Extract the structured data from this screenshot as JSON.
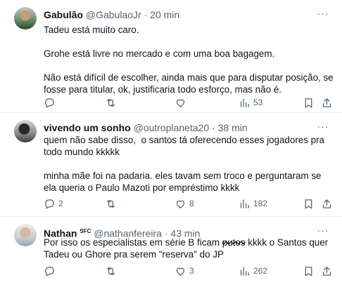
{
  "tweets": [
    {
      "name": "Gabulão",
      "handle": "@GabulaoJr",
      "separator": "·",
      "time": "20 min",
      "badge": "",
      "paragraphs": [
        "Tadeu está muito caro.",
        "Grohe está livre no mercado e com uma boa bagagem.",
        "Não está difícil de escolher, ainda mais que para disputar posição, se fosse para titular, ok, justificaria todo esforço, mas não é."
      ],
      "stats": {
        "replies": "",
        "retweets": "",
        "likes": "",
        "views": "53"
      }
    },
    {
      "name": "vivendo um sonho",
      "handle": "@outroplaneta20",
      "separator": "·",
      "time": "38 min",
      "badge": "",
      "paragraphs": [
        "quem não sabe disso,  o santos tá oferecendo esses jogadores pra todo mundo kkkkk",
        "minha mãe foi na padaria. eles tavam sem troco e perguntaram se ela queria o Paulo Mazoti por empréstimo kkkk"
      ],
      "stats": {
        "replies": "2",
        "retweets": "",
        "likes": "8",
        "views": "182"
      }
    },
    {
      "name": "Nathan",
      "badge": "SFC",
      "handle": "@nathanfereira",
      "separator": "·",
      "time": "43 min",
      "text_before": "Por isso os especialistas em série B ficam ",
      "text_struck": "putos",
      "text_after": " kkkk o Santos quer Tadeu ou Ghore pra serem \"reserva\" do JP",
      "stats": {
        "replies": "",
        "retweets": "",
        "likes": "3",
        "views": "262"
      }
    }
  ],
  "icons": {
    "reply": "reply-icon",
    "retweet": "retweet-icon",
    "like": "heart-icon",
    "views": "views-chart-icon",
    "bookmark": "bookmark-icon",
    "share": "share-icon",
    "more": "more-dots-icon"
  }
}
